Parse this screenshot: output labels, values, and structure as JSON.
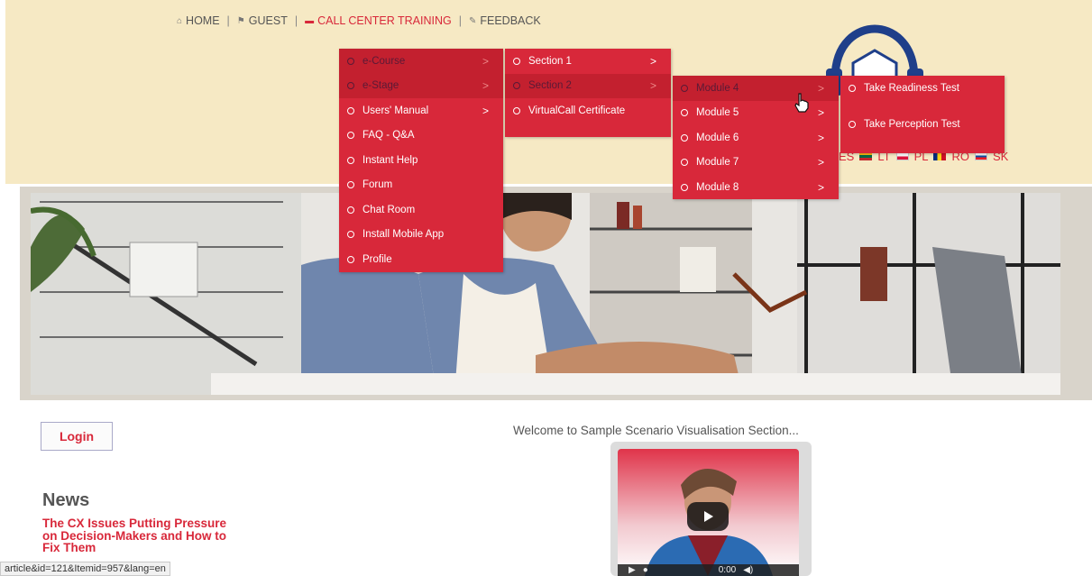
{
  "top_nav": {
    "home": "HOME",
    "guest": "GUEST",
    "training": "CALL CENTER TRAINING",
    "feedback": "FEEDBACK",
    "separator": "|"
  },
  "languages": [
    "ES",
    "LT",
    "PL",
    "RO",
    "SK"
  ],
  "menus": {
    "level1": [
      {
        "label": "e-Course",
        "arrow": ">",
        "highlight": true
      },
      {
        "label": "e-Stage",
        "arrow": ">",
        "highlight": true
      },
      {
        "label": "Users' Manual",
        "arrow": ">"
      },
      {
        "label": "FAQ - Q&A"
      },
      {
        "label": "Instant Help"
      },
      {
        "label": "Forum"
      },
      {
        "label": "Chat Room"
      },
      {
        "label": "Install Mobile App"
      },
      {
        "label": "Profile"
      }
    ],
    "level2": [
      {
        "label": "Section 1",
        "arrow": ">"
      },
      {
        "label": "Section 2",
        "arrow": ">",
        "highlight": true
      },
      {
        "label": "VirtualCall Certificate"
      }
    ],
    "level3": [
      {
        "label": "Module 4",
        "arrow": ">",
        "highlight": true
      },
      {
        "label": "Module 5",
        "arrow": ">"
      },
      {
        "label": "Module 6",
        "arrow": ">"
      },
      {
        "label": "Module 7",
        "arrow": ">"
      },
      {
        "label": "Module 8",
        "arrow": ">"
      }
    ],
    "level4": [
      {
        "label": "Take Readiness Test"
      },
      {
        "label": "Take Perception Test"
      }
    ]
  },
  "login": {
    "label": "Login"
  },
  "news": {
    "title": "News",
    "article": "The CX Issues Putting Pressure on Decision-Makers and How to Fix Them"
  },
  "welcome": "Welcome to Sample Scenario Visualisation Section...",
  "video": {
    "time": "0:00"
  },
  "status_url": "article&id=121&Itemid=957&lang=en",
  "colors": {
    "accent": "#d8283a",
    "header_bg": "#f6e9c4",
    "logo_navy": "#1f3f8a"
  }
}
